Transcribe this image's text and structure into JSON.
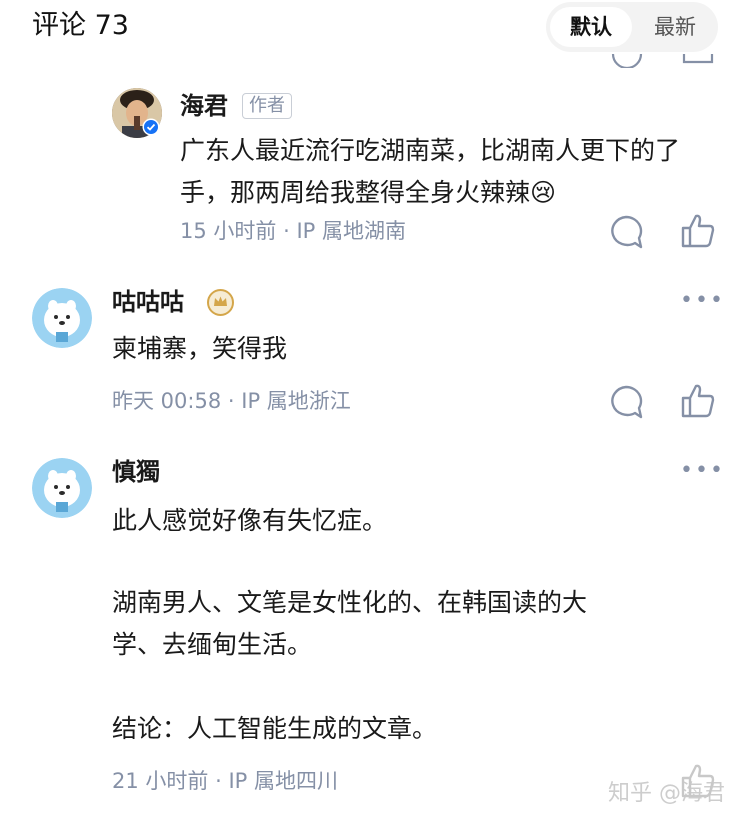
{
  "header": {
    "title": "评论 73",
    "sort_default": "默认",
    "sort_latest": "最新"
  },
  "comments": [
    {
      "user": "海君",
      "badge": "作者",
      "text": "广东人最近流行吃湖南菜，比湖南人更下的了手，那两周给我整得全身火辣辣",
      "emoji": "😢",
      "time": "15 小时前",
      "ip": "IP 属地湖南"
    },
    {
      "user": "咕咕咕",
      "text": "柬埔寨，笑得我",
      "time": "昨天 00:58",
      "ip": "IP 属地浙江"
    },
    {
      "user": "慎獨",
      "text_lines": [
        "此人感觉好像有失忆症。",
        "湖南男人、文笔是女性化的、在韩国读的大",
        "学、去缅甸生活。",
        "结论：人工智能生成的文章。"
      ],
      "time": "21 小时前",
      "ip": "IP 属地四川"
    }
  ],
  "separator": "·",
  "icons": {
    "comment": "comment-bubble-icon",
    "like": "thumbs-up-icon",
    "more": "more-dots-icon",
    "verified": "verified-badge-icon",
    "crown": "crown-badge-icon"
  },
  "watermark": "知乎 @海君",
  "colors": {
    "meta": "#8590a6",
    "verified": "#1772f6",
    "crown": "#d4a64a"
  }
}
